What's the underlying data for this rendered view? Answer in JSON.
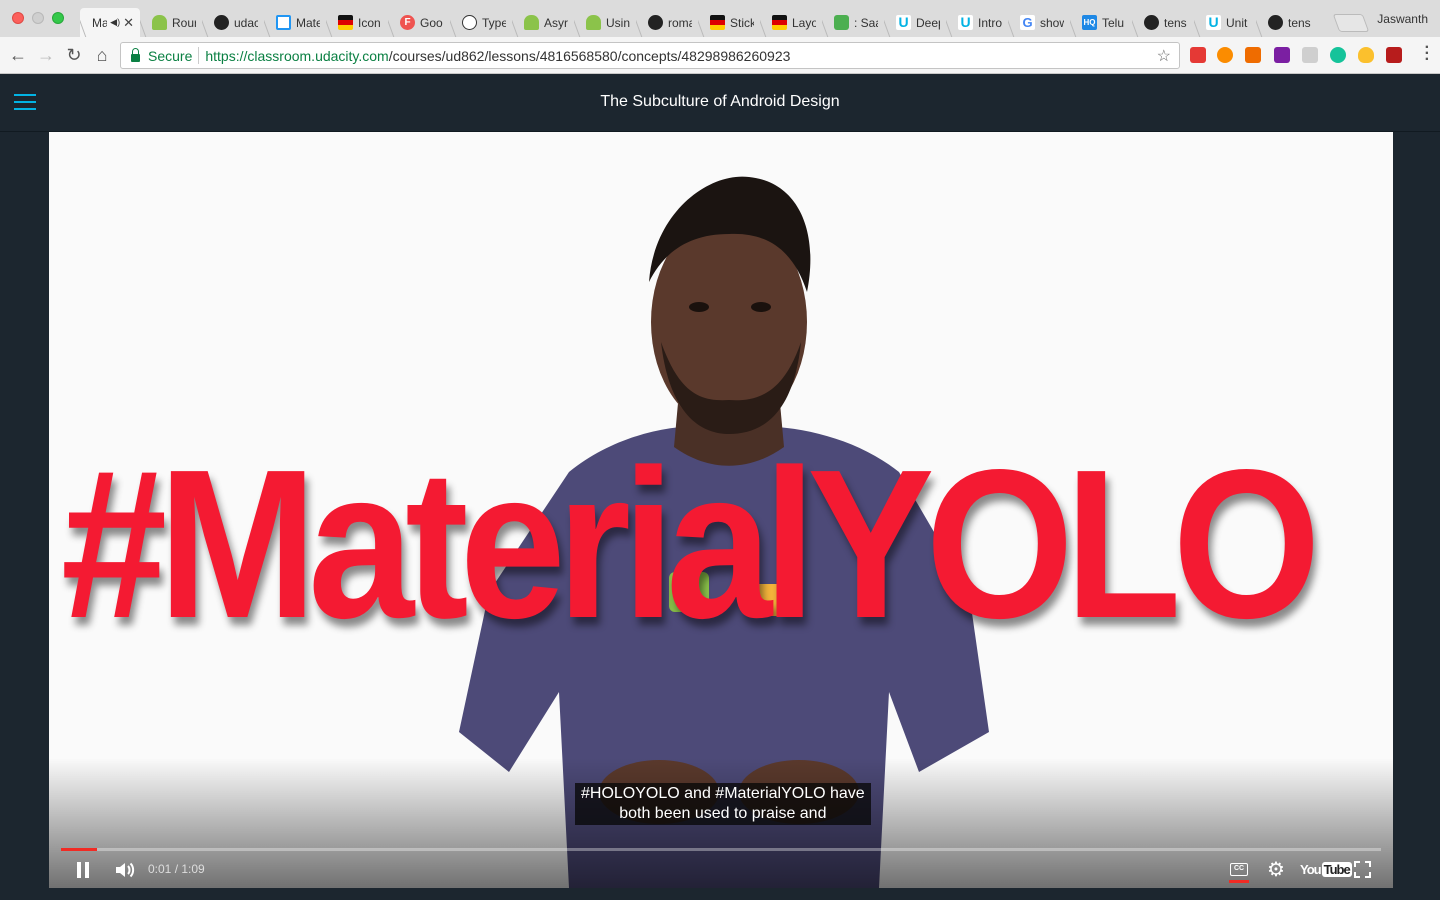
{
  "browser": {
    "profile_name": "Jaswanth",
    "tabs": [
      {
        "title": "Mat",
        "favicon": "udacity-icon",
        "active": true,
        "audio": true
      },
      {
        "title": "Rour",
        "favicon": "android-icon"
      },
      {
        "title": "udac",
        "favicon": "github-icon"
      },
      {
        "title": "Mate",
        "favicon": "material-icon"
      },
      {
        "title": "Icon",
        "favicon": "flag-icon"
      },
      {
        "title": "Goo",
        "favicon": "letter-f-icon"
      },
      {
        "title": "Type",
        "favicon": "typekit-icon"
      },
      {
        "title": "Asyr",
        "favicon": "android-icon"
      },
      {
        "title": "Usin",
        "favicon": "android-icon"
      },
      {
        "title": "roma",
        "favicon": "github-icon"
      },
      {
        "title": "Stick",
        "favicon": "flag-icon"
      },
      {
        "title": "Layo",
        "favicon": "flag-icon"
      },
      {
        "title": ": Saa",
        "favicon": "sn-icon"
      },
      {
        "title": "Deep",
        "favicon": "udacity-icon"
      },
      {
        "title": "Intro",
        "favicon": "udacity-icon"
      },
      {
        "title": "show",
        "favicon": "google-icon"
      },
      {
        "title": "Telu",
        "favicon": "hq-icon"
      },
      {
        "title": "tens",
        "favicon": "github-icon"
      },
      {
        "title": "Unit",
        "favicon": "udacity-icon"
      },
      {
        "title": "tens",
        "favicon": "github-icon"
      }
    ],
    "address_bar": {
      "secure_label": "Secure",
      "url_scheme_host": "https://classroom.udacity.com",
      "url_path": "/courses/ud862/lessons/4816568580/concepts/48298986260923"
    },
    "colors": {
      "secure": "#0b8043",
      "accent": "#02b3e4"
    }
  },
  "page": {
    "lesson_title": "The Subculture of Android Design"
  },
  "video": {
    "overlay_text": "#MaterialYOLO",
    "caption_line1": "#HOLOYOLO and #MaterialYOLO have",
    "caption_line2": "both been used to praise and",
    "current_time": "0:01",
    "duration": "1:09",
    "time_display": "0:01 / 1:09",
    "progress_fraction": 0.027,
    "state": "playing",
    "brand": "YouTube",
    "colors": {
      "progress": "#f12b24",
      "overlay_text": "#f41a32"
    }
  }
}
